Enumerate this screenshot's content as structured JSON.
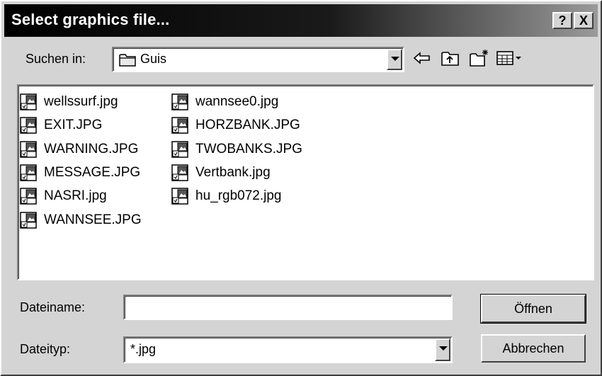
{
  "window": {
    "title": "Select graphics file...",
    "help_label": "?",
    "close_label": "X"
  },
  "lookin": {
    "label": "Suchen in:",
    "folder": "Guis"
  },
  "files": [
    "wellssurf.jpg",
    "EXIT.JPG",
    "WARNING.JPG",
    "MESSAGE.JPG",
    "NASRI.jpg",
    "WANNSEE.JPG",
    "wannsee0.jpg",
    "HORZBANK.JPG",
    "TWOBANKS.JPG",
    "Vertbank.jpg",
    "hu_rgb072.jpg"
  ],
  "filename": {
    "label": "Dateiname:",
    "value": ""
  },
  "filetype": {
    "label": "Dateityp:",
    "value": "*.jpg"
  },
  "buttons": {
    "open": "Öffnen",
    "cancel": "Abbrechen"
  },
  "icons": [
    "folder-icon",
    "back-arrow-icon",
    "up-folder-icon",
    "new-folder-icon",
    "view-menu-icon",
    "image-file-icon",
    "dropdown-arrow-icon"
  ]
}
